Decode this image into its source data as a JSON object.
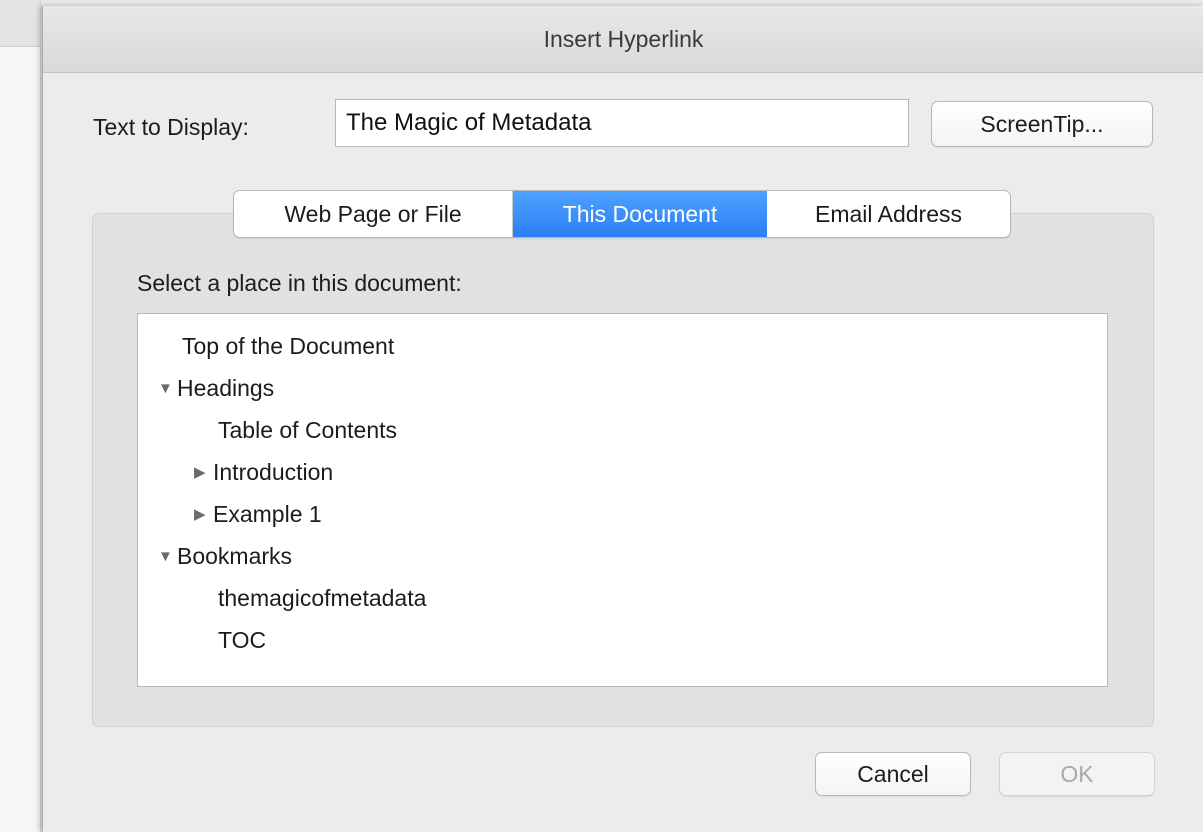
{
  "dialog": {
    "title": "Insert Hyperlink",
    "text_to_display_label": "Text to Display:",
    "text_to_display_value": "The Magic of Metadata",
    "screentip_button": "ScreenTip...",
    "tabs": [
      {
        "label": "Web Page or File",
        "selected": false
      },
      {
        "label": "This Document",
        "selected": true
      },
      {
        "label": "Email Address",
        "selected": false
      }
    ],
    "select_label": "Select a place in this document:",
    "tree": {
      "top": "Top of the Document",
      "headings": "Headings",
      "toc": "Table of Contents",
      "introduction": "Introduction",
      "example1": "Example 1",
      "bookmarks": "Bookmarks",
      "bm1": "themagicofmetadata",
      "bm2": "TOC"
    },
    "cancel_button": "Cancel",
    "ok_button": "OK"
  },
  "colors": {
    "accent": "#2a80f5",
    "disabled_text": "#a9a9a9"
  },
  "icons": {
    "expanded": "triangle-down-icon",
    "collapsed": "triangle-right-icon"
  }
}
